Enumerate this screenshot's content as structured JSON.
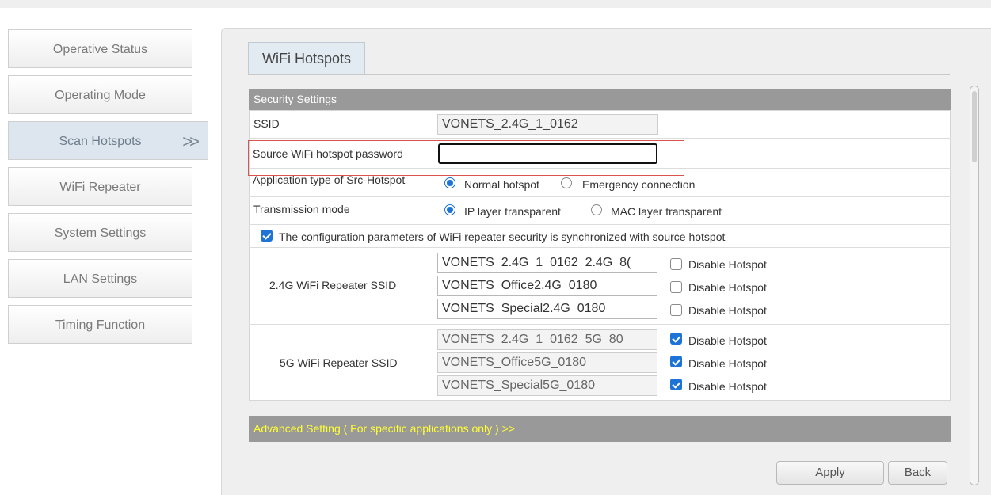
{
  "sidebar": {
    "items": [
      {
        "label": "Operative Status"
      },
      {
        "label": "Operating Mode"
      },
      {
        "label": "Scan Hotspots",
        "chevron": ">>"
      },
      {
        "label": "WiFi Repeater"
      },
      {
        "label": "System Settings"
      },
      {
        "label": "LAN Settings"
      },
      {
        "label": "Timing Function"
      }
    ]
  },
  "tab": {
    "label": "WiFi Hotspots"
  },
  "section": {
    "title": "Security Settings"
  },
  "form": {
    "ssid_label": "SSID",
    "ssid_value": "VONETS_2.4G_1_0162",
    "password_label": "Source WiFi hotspot password",
    "password_value": "",
    "app_type_label": "Application type of Src-Hotspot",
    "app_type_options": [
      {
        "label": "Normal hotspot",
        "checked": true
      },
      {
        "label": "Emergency connection",
        "checked": false
      }
    ],
    "trans_label": "Transmission mode",
    "trans_options": [
      {
        "label": "IP layer transparent",
        "checked": true
      },
      {
        "label": "MAC layer transparent",
        "checked": false
      }
    ],
    "sync_label": "The configuration parameters of WiFi repeater security is synchronized with source hotspot",
    "sync_checked": true,
    "repeater_24_label": "2.4G WiFi Repeater SSID",
    "repeater_24": [
      {
        "ssid": "VONETS_2.4G_1_0162_2.4G_8(",
        "disable_label": "Disable Hotspot",
        "disabled": false
      },
      {
        "ssid": "VONETS_Office2.4G_0180",
        "disable_label": "Disable Hotspot",
        "disabled": false
      },
      {
        "ssid": "VONETS_Special2.4G_0180",
        "disable_label": "Disable Hotspot",
        "disabled": false
      }
    ],
    "repeater_5_label": "5G WiFi Repeater SSID",
    "repeater_5": [
      {
        "ssid": "VONETS_2.4G_1_0162_5G_80",
        "disable_label": "Disable Hotspot",
        "disabled": true
      },
      {
        "ssid": "VONETS_Office5G_0180",
        "disable_label": "Disable Hotspot",
        "disabled": true
      },
      {
        "ssid": "VONETS_Special5G_0180",
        "disable_label": "Disable Hotspot",
        "disabled": true
      }
    ]
  },
  "advanced": {
    "label": "Advanced Setting ( For specific applications only ) >>"
  },
  "buttons": {
    "apply": "Apply",
    "back": "Back"
  },
  "colors": {
    "section_header": "#999999",
    "advanced_text": "#ffff33",
    "accent": "#1e74d6",
    "highlight": "#d9534f"
  }
}
